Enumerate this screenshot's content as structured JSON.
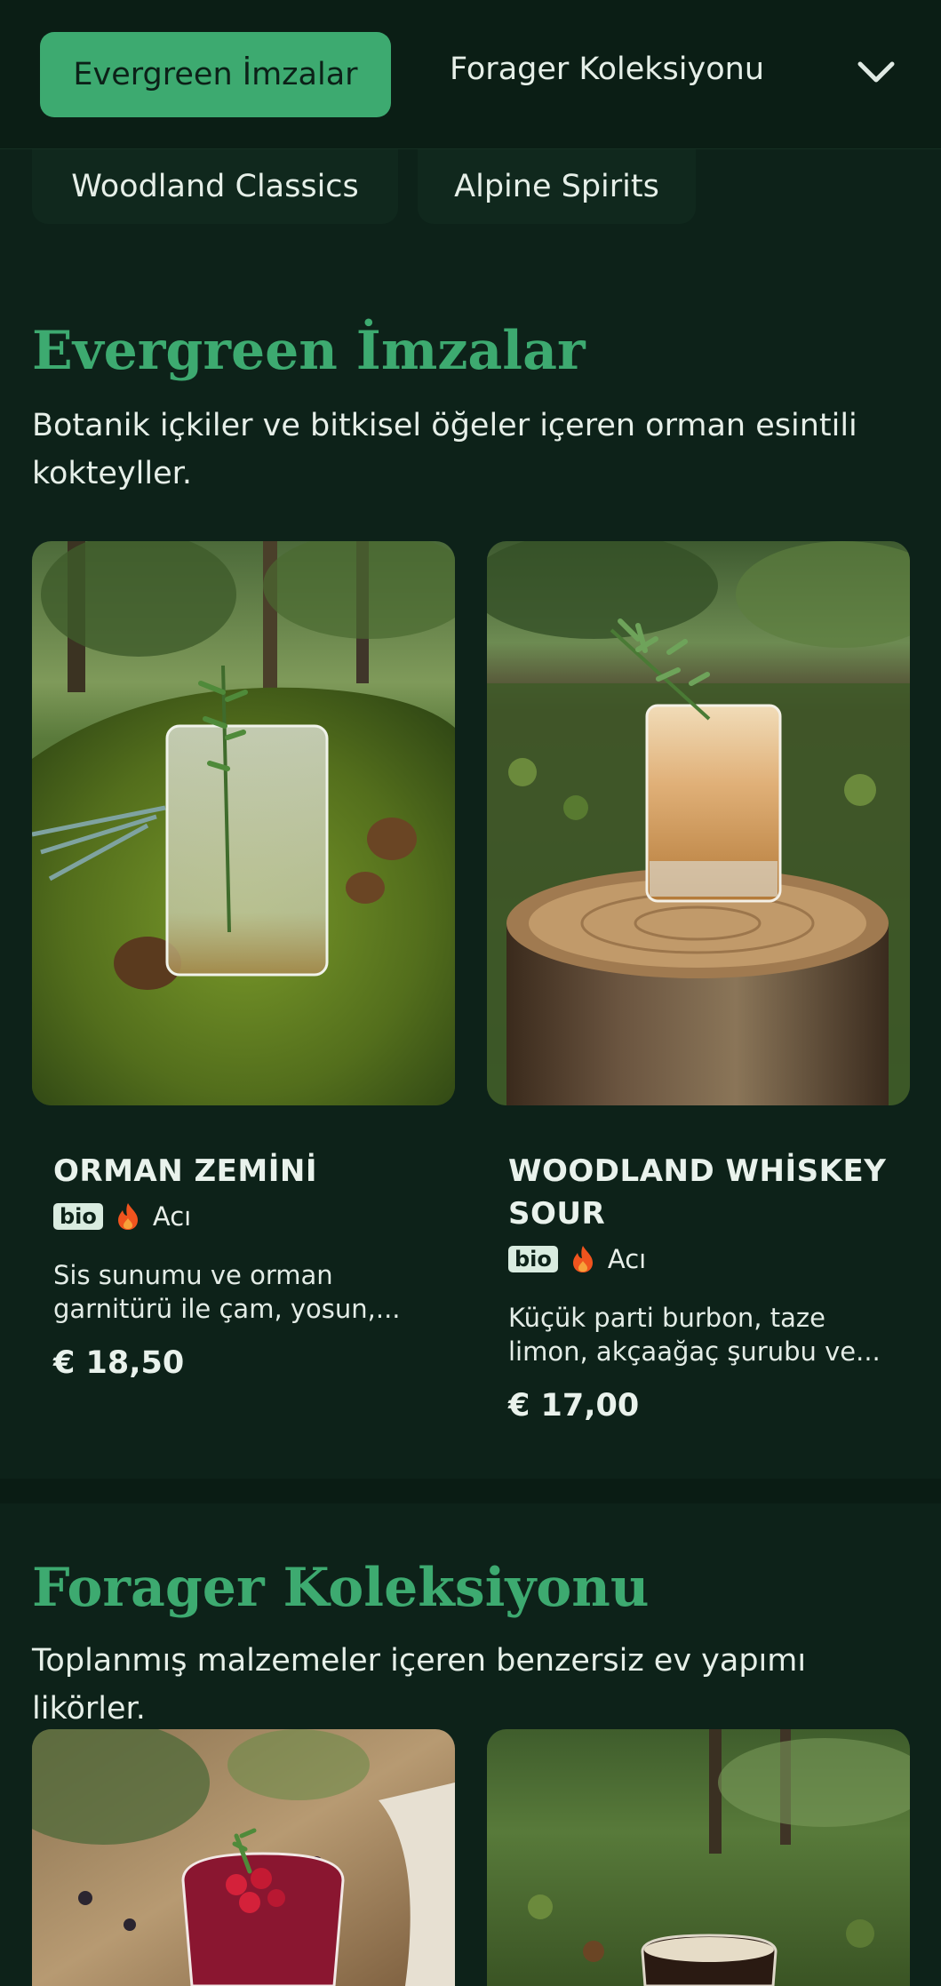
{
  "nav": {
    "active_tab": "Evergreen İmzalar",
    "next_tab": "Forager Koleksiyonu",
    "chevron": "chevron-down-icon",
    "chips": [
      "Woodland Classics",
      "Alpine Spirits"
    ]
  },
  "sections": [
    {
      "title": "Evergreen İmzalar",
      "description": "Botanik içkiler ve bitkisel öğeler içeren orman esintili kokteyller.",
      "items": [
        {
          "name": "ORMAN ZEMİNİ",
          "badge": "bio",
          "tag_icon": "flame-icon",
          "tag": "Acı",
          "description_line1": "Sis sunumu ve orman",
          "description_line2": "garnitürü ile çam, yosun,...",
          "price": "€ 18,50"
        },
        {
          "name_line1": "WOODLAND WHİSKEY",
          "name_line2": "SOUR",
          "badge": "bio",
          "tag_icon": "flame-icon",
          "tag": "Acı",
          "description_line1": "Küçük parti burbon, taze",
          "description_line2": "limon, akçaağaç şurubu ve...",
          "price": "€ 17,00"
        }
      ]
    },
    {
      "title": "Forager Koleksiyonu",
      "description": "Toplanmış malzemeler içeren benzersiz ev yapımı likörler."
    }
  ],
  "colors": {
    "background": "#0d2219",
    "accent": "#3daa70",
    "flame": "#f0541e"
  }
}
